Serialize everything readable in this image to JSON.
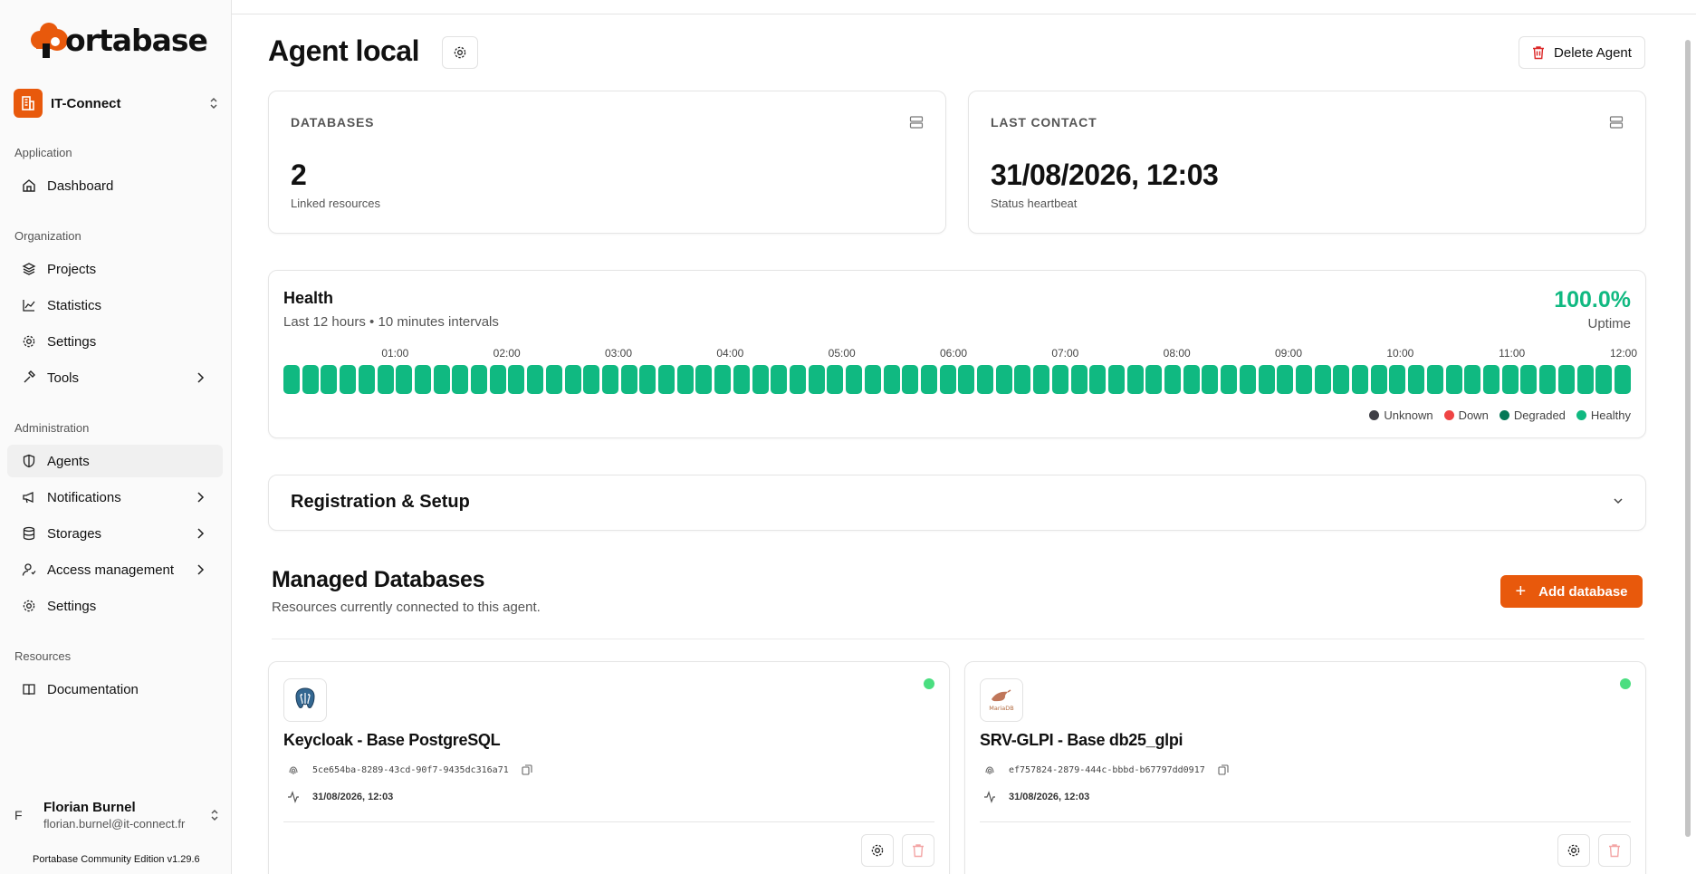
{
  "brand": {
    "logo_text": "ortabase"
  },
  "org": {
    "name": "IT-Connect"
  },
  "sidebar": {
    "sections": [
      {
        "label": "Application"
      },
      {
        "label": "Organization"
      },
      {
        "label": "Administration"
      },
      {
        "label": "Resources"
      }
    ],
    "items": [
      {
        "label": "Dashboard",
        "icon": "home-icon"
      },
      {
        "label": "Projects",
        "icon": "layers-icon"
      },
      {
        "label": "Statistics",
        "icon": "chart-icon"
      },
      {
        "label": "Settings",
        "icon": "gear-icon"
      },
      {
        "label": "Tools",
        "icon": "hammer-icon"
      },
      {
        "label": "Agents",
        "icon": "shield-icon"
      },
      {
        "label": "Notifications",
        "icon": "megaphone-icon"
      },
      {
        "label": "Storages",
        "icon": "database-icon"
      },
      {
        "label": "Access management",
        "icon": "user-icon"
      },
      {
        "label": "Settings",
        "icon": "gear-icon"
      },
      {
        "label": "Documentation",
        "icon": "book-icon"
      }
    ],
    "active_item": "Agents"
  },
  "user": {
    "initial": "F",
    "name": "Florian Burnel",
    "email": "florian.burnel@it-connect.fr"
  },
  "version": "Portabase Community Edition v1.29.6",
  "page": {
    "title": "Agent local",
    "delete_label": "Delete Agent"
  },
  "stats": {
    "databases": {
      "label": "DATABASES",
      "value": "2",
      "sub": "Linked resources"
    },
    "last_contact": {
      "label": "LAST CONTACT",
      "value": "31/08/2026, 12:03",
      "sub": "Status heartbeat"
    }
  },
  "health": {
    "title": "Health",
    "subtitle": "Last 12 hours • 10 minutes intervals",
    "uptime_value": "100.0%",
    "uptime_label": "Uptime",
    "times": [
      "01:00",
      "02:00",
      "03:00",
      "04:00",
      "05:00",
      "06:00",
      "07:00",
      "08:00",
      "09:00",
      "10:00",
      "11:00",
      "12:00"
    ],
    "interval_count": 72,
    "interval_status": "Healthy",
    "legend": [
      {
        "label": "Unknown",
        "color": "#3f3f46"
      },
      {
        "label": "Down",
        "color": "#ef4444"
      },
      {
        "label": "Degraded",
        "color": "#047857"
      },
      {
        "label": "Healthy",
        "color": "#10b981"
      }
    ]
  },
  "registration": {
    "title": "Registration & Setup"
  },
  "managed": {
    "title": "Managed Databases",
    "subtitle": "Resources currently connected to this agent.",
    "add_label": "Add database",
    "databases": [
      {
        "name": "Keycloak - Base PostgreSQL",
        "id": "5ce654ba-8289-43cd-90f7-9435dc316a71",
        "date": "31/08/2026, 12:03",
        "logo": "postgresql-logo",
        "status_color": "#4ade80"
      },
      {
        "name": "SRV-GLPI - Base db25_glpi",
        "id": "ef757824-2879-444c-bbbd-b67797dd0917",
        "date": "31/08/2026, 12:03",
        "logo": "mariadb-logo",
        "logo_text": "MariaDB",
        "status_color": "#4ade80"
      }
    ]
  },
  "colors": {
    "accent": "#e8590c",
    "healthy": "#10b981"
  }
}
